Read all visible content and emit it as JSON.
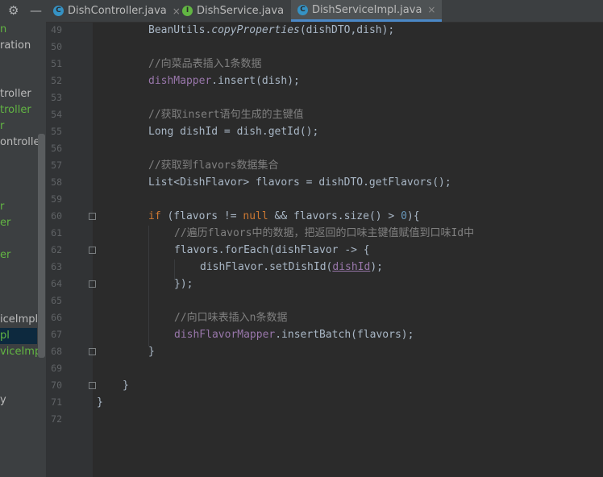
{
  "project_tree": {
    "items": [
      {
        "label": "n",
        "color": "#62b543"
      },
      {
        "label": "ration",
        "color": "#bbbbbb"
      },
      {
        "label": "troller",
        "color": "#bbbbbb"
      },
      {
        "label": "troller",
        "color": "#62b543"
      },
      {
        "label": "r",
        "color": "#62b543"
      },
      {
        "label": "ontroller",
        "color": "#bbbbbb"
      },
      {
        "label": "r",
        "color": "#62b543"
      },
      {
        "label": "er",
        "color": "#62b543"
      },
      {
        "label": "er",
        "color": "#62b543"
      },
      {
        "label": "iceImpl",
        "color": "#bbbbbb"
      },
      {
        "label": "pl",
        "color": "#62b543",
        "selected": true
      },
      {
        "label": "viceImp",
        "color": "#62b543"
      },
      {
        "label": "y",
        "color": "#bbbbbb"
      }
    ]
  },
  "tabs": [
    {
      "label": "DishController.java",
      "icon": "class-icon",
      "icon_letter": "C",
      "icon_color": "#3592c4",
      "active": false
    },
    {
      "label": "DishService.java",
      "icon": "interface-icon",
      "icon_letter": "I",
      "icon_color": "#62b543",
      "active": false
    },
    {
      "label": "DishServiceImpl.java",
      "icon": "class-icon",
      "icon_letter": "C",
      "icon_color": "#3592c4",
      "active": true
    }
  ],
  "close_glyph": "×",
  "line_numbers": [
    "49",
    "50",
    "51",
    "52",
    "53",
    "54",
    "55",
    "56",
    "57",
    "58",
    "59",
    "60",
    "61",
    "62",
    "63",
    "64",
    "65",
    "66",
    "67",
    "68",
    "69",
    "70",
    "71",
    "72"
  ],
  "code": {
    "l49": {
      "a": "BeanUtils.",
      "b": "copyProperties",
      "c": "(dishDTO,dish);"
    },
    "l51": "//向菜品表插入1条数据",
    "l52": {
      "a": "dishMapper",
      "b": ".insert(dish);"
    },
    "l54": "//获取insert语句生成的主键值",
    "l55": "Long dishId = dish.getId();",
    "l57": "//获取到flavors数据集合",
    "l58": "List<DishFlavor> flavors = dishDTO.getFlavors();",
    "l60": {
      "kw": "if",
      "a": " (flavors != ",
      "null": "null",
      "b": " && flavors.size() > ",
      "num": "0",
      "c": "){"
    },
    "l61": "//遍历flavors中的数据，把返回的口味主键值赋值到口味Id中",
    "l62": "flavors.forEach(dishFlavor -> {",
    "l63": {
      "a": "dishFlavor.setDishId(",
      "b": "dishId",
      "c": ");"
    },
    "l64": "});",
    "l66": "//向口味表插入n条数据",
    "l67": {
      "a": "dishFlavorMapper",
      "b": ".insertBatch(flavors);"
    },
    "l68": "}",
    "l70": "}",
    "l71": "}"
  }
}
